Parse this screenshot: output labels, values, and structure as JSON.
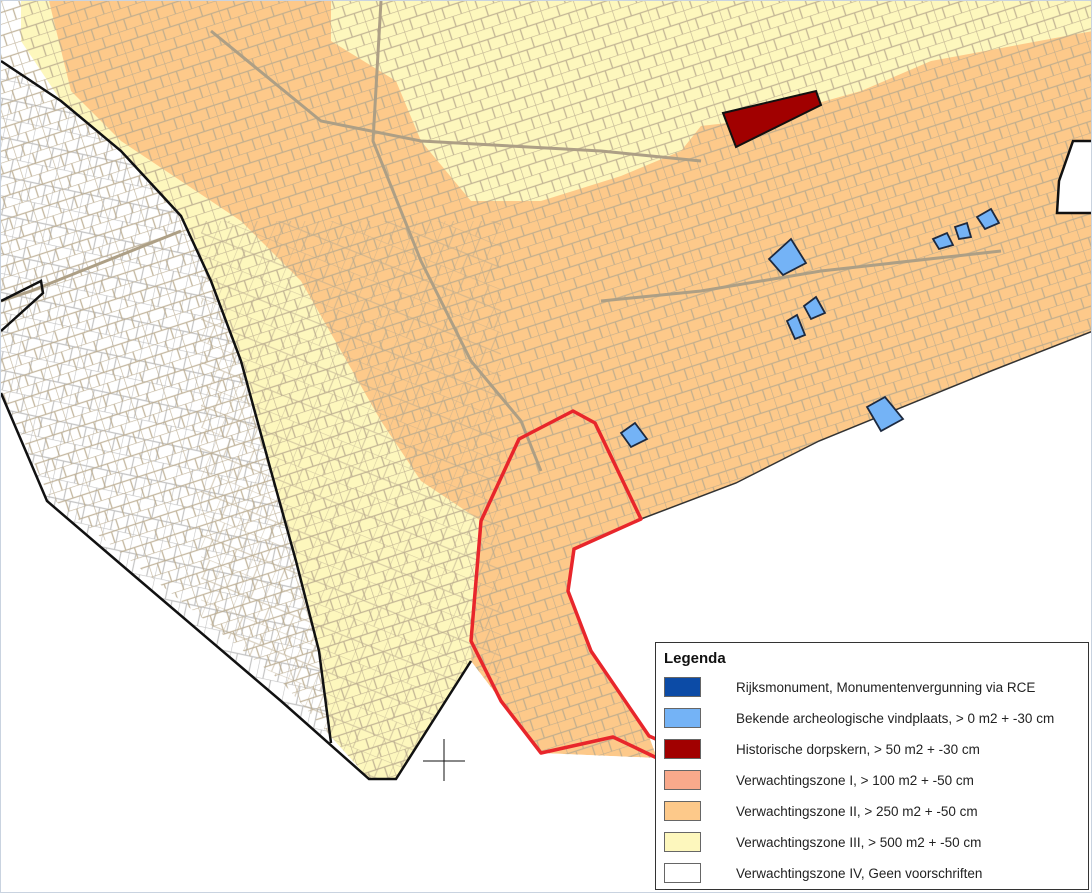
{
  "legend": {
    "title": "Legenda",
    "items": [
      {
        "label": "Rijksmonument, Monumentenvergunning via RCE",
        "color": "#0c4ba6"
      },
      {
        "label": "Bekende archeologische vindplaats, > 0 m2 + -30 cm",
        "color": "#74b3f6"
      },
      {
        "label": "Historische dorpskern, > 50 m2 + -30 cm",
        "color": "#a10000"
      },
      {
        "label": "Verwachtingszone I, > 100 m2 + -50 cm",
        "color": "#f9a98b"
      },
      {
        "label": "Verwachtingszone II, > 250 m2 + -50 cm",
        "color": "#fdc98a"
      },
      {
        "label": "Verwachtingszone III, > 500 m2 + -50 cm",
        "color": "#fdf7bd"
      },
      {
        "label": "Verwachtingszone IV, Geen voorschriften",
        "color": "#ffffff"
      }
    ]
  },
  "map": {
    "zone_colors": {
      "zone_iii": "#fdf7bd",
      "zone_ii": "#fdc98a",
      "historic_core": "#a10000",
      "findspot": "#74b3f6",
      "plan_area_outline": "#e8262b",
      "parcel_lines": "#b9aa8e",
      "outside_parcels": "#c4c4c4"
    },
    "cursor_icon": "crosshair-icon"
  }
}
